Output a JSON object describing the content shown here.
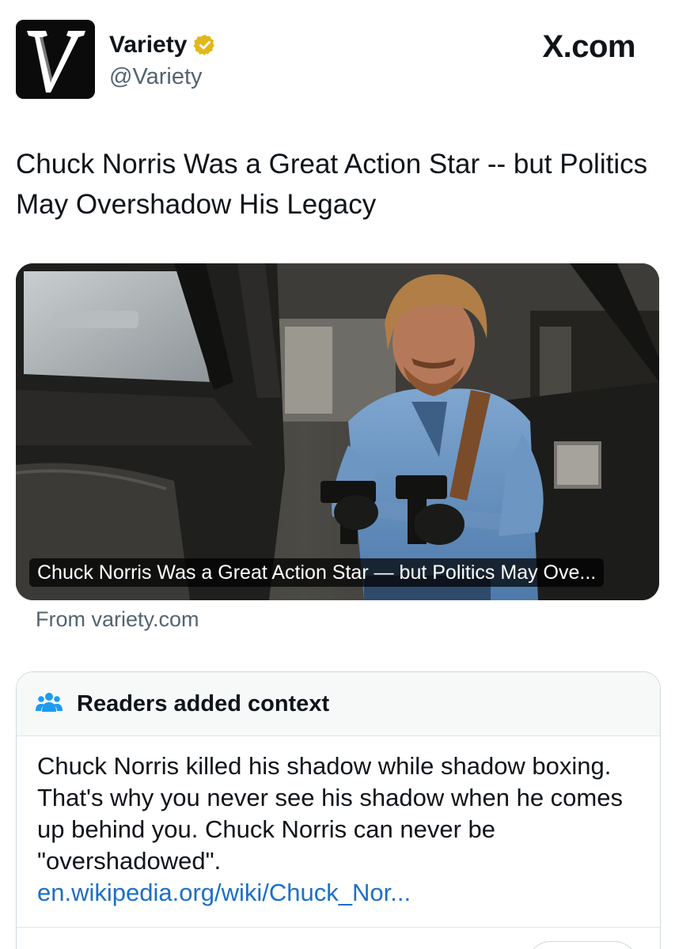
{
  "header": {
    "display_name": "Variety",
    "handle": "@Variety",
    "site_mark": "X.com",
    "avatar_icon": "variety-v-logo",
    "verified_icon": "gold-verified-badge-icon",
    "verified_color": "#e2b719"
  },
  "tweet": {
    "text": "Chuck Norris Was a Great Action Star -- but Politics May Overshadow His Legacy"
  },
  "card": {
    "image_icon": "chuck-norris-photo",
    "caption": "Chuck Norris Was a Great Action Star — but Politics May Ove...",
    "source": "From variety.com"
  },
  "community_note": {
    "title": "Readers added context",
    "icon": "people-icon",
    "accent": "#1d9bf0",
    "body": "Chuck Norris killed his shadow while shadow boxing. That's why you never see his shadow when he comes up behind you. Chuck Norris can never be \"overshadowed\".",
    "link": "en.wikipedia.org/wiki/Chuck_Nor..."
  }
}
